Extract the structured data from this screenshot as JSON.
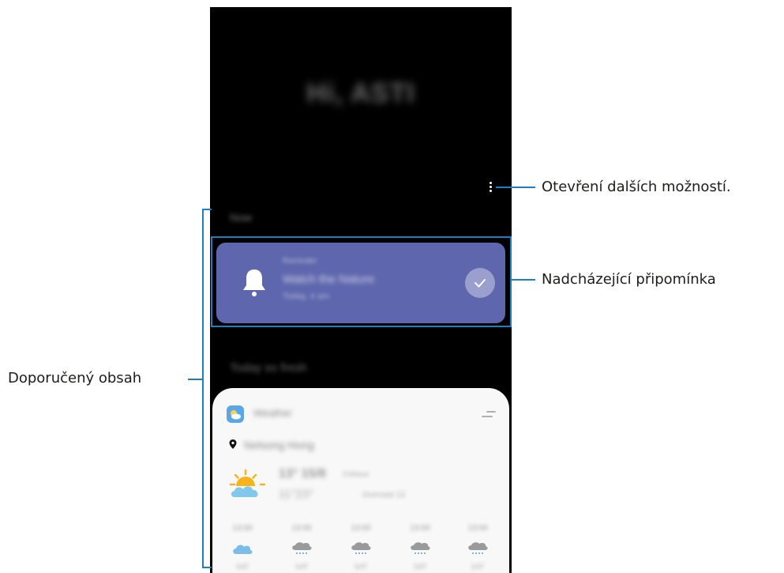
{
  "phone": {
    "greeting": "Hi, ASTI",
    "section_now": "Now",
    "reminder": {
      "category": "Reminder",
      "title": "Watch the Nature",
      "time": "Today, 4 am"
    },
    "section_today": "Today so fresh",
    "weather": {
      "app_name": "Weather",
      "location": "Nelsong Hong",
      "temperature": "13°  15/8",
      "unit": "Celsius",
      "description": "11°23° ",
      "date": "Overcast 13",
      "hours": [
        {
          "time": "13:00",
          "day": "SAT",
          "icon": "cloud-icon"
        },
        {
          "time": "13:00",
          "day": "SAT",
          "icon": "rain-cloud-icon"
        },
        {
          "time": "13:00",
          "day": "SAT",
          "icon": "rain-cloud-icon"
        },
        {
          "time": "13:00",
          "day": "SAT",
          "icon": "rain-cloud-icon"
        },
        {
          "time": "13:00",
          "day": "SAT",
          "icon": "rain-cloud-icon"
        }
      ]
    }
  },
  "callouts": {
    "more_options": "Otevření dalších možností.",
    "upcoming_reminder": "Nadcházející připomínka",
    "recommended_content": "Doporučený obsah"
  },
  "colors": {
    "annotation_line": "#1c7fbf",
    "reminder_card": "#5e67ad",
    "phone_background": "#000000"
  }
}
